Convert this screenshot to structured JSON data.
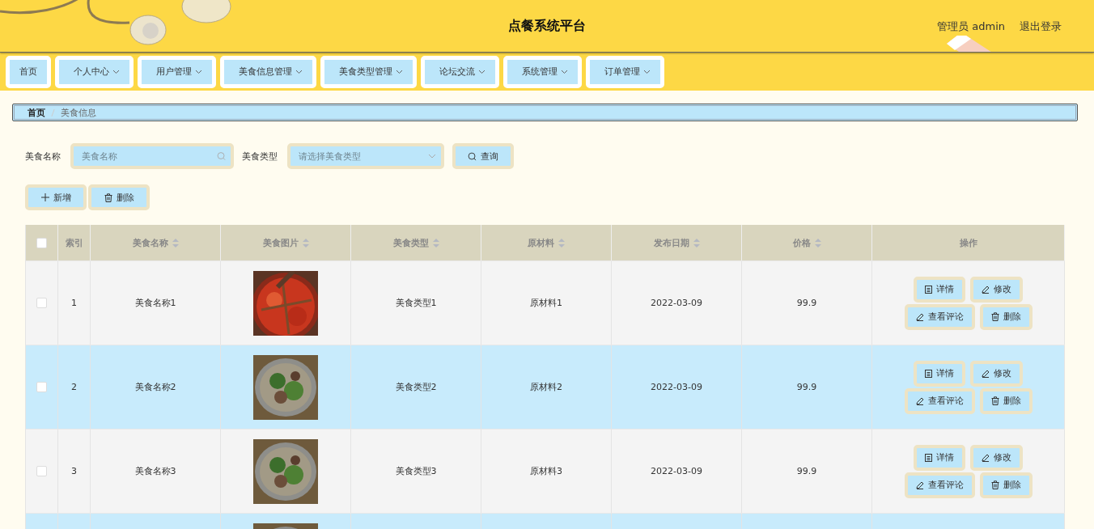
{
  "header": {
    "title": "点餐系统平台",
    "user": "管理员 admin",
    "logout": "退出登录"
  },
  "nav": [
    {
      "label": "首页",
      "dropdown": false
    },
    {
      "label": "个人中心",
      "dropdown": true
    },
    {
      "label": "用户管理",
      "dropdown": true
    },
    {
      "label": "美食信息管理",
      "dropdown": true
    },
    {
      "label": "美食类型管理",
      "dropdown": true
    },
    {
      "label": "论坛交流",
      "dropdown": true
    },
    {
      "label": "系统管理",
      "dropdown": true
    },
    {
      "label": "订单管理",
      "dropdown": true
    }
  ],
  "breadcrumb": [
    "首页",
    "美食信息"
  ],
  "search": {
    "name_label": "美食名称",
    "name_placeholder": "美食名称",
    "type_label": "美食类型",
    "type_placeholder": "请选择美食类型",
    "button": "查询"
  },
  "actions": [
    "新增",
    "删除"
  ],
  "table": {
    "columns": [
      {
        "label": "索引",
        "sortable": false
      },
      {
        "label": "美食名称",
        "sortable": true
      },
      {
        "label": "美食图片",
        "sortable": true
      },
      {
        "label": "美食类型",
        "sortable": true
      },
      {
        "label": "原材料",
        "sortable": true
      },
      {
        "label": "发布日期",
        "sortable": true
      },
      {
        "label": "价格",
        "sortable": true
      },
      {
        "label": "操作",
        "sortable": false
      }
    ],
    "all_checked": false,
    "rows": [
      {
        "checked": false,
        "index": "1",
        "name": "美食名称1",
        "type": "美食类型1",
        "material": "原材料1",
        "date": "2022-03-09",
        "price": "99.9",
        "buttons": [
          "详情",
          "修改",
          "查看评论",
          "删除"
        ]
      },
      {
        "checked": false,
        "index": "2",
        "name": "美食名称2",
        "type": "美食类型2",
        "material": "原材料2",
        "date": "2022-03-09",
        "price": "99.9",
        "buttons": [
          "详情",
          "修改",
          "查看评论",
          "删除"
        ]
      },
      {
        "checked": false,
        "index": "3",
        "name": "美食名称3",
        "type": "美食类型3",
        "material": "原材料3",
        "date": "2022-03-09",
        "price": "99.9",
        "buttons": [
          "详情",
          "修改",
          "查看评论",
          "删除"
        ]
      }
    ]
  }
}
